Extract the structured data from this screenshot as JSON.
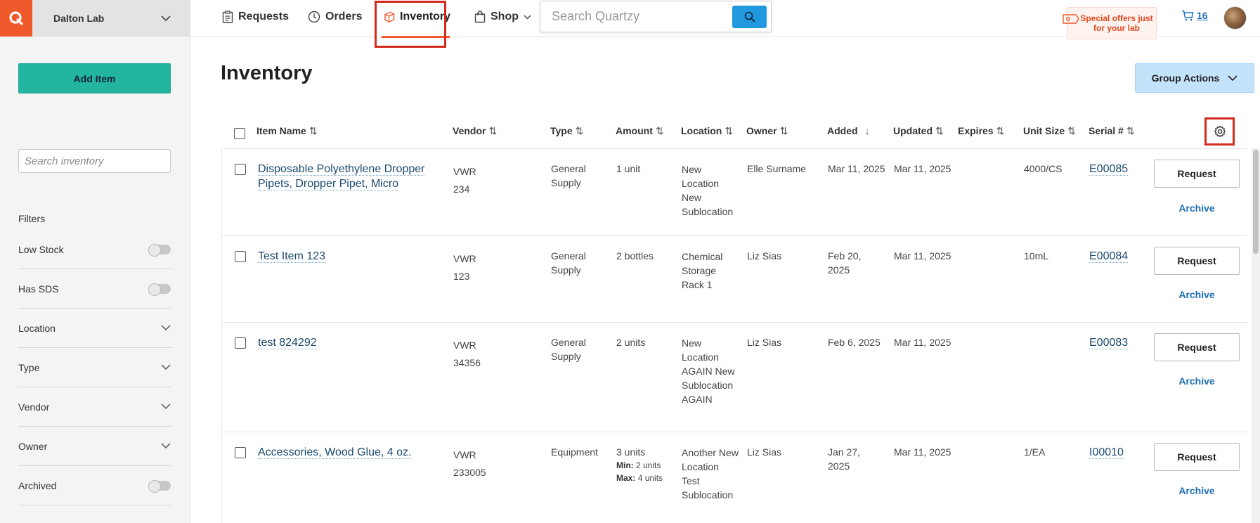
{
  "lab": {
    "name": "Dalton Lab"
  },
  "sidebar": {
    "add_item_label": "Add Item",
    "search_placeholder": "Search inventory",
    "filters_title": "Filters",
    "filters": [
      {
        "label": "Low Stock",
        "kind": "toggle"
      },
      {
        "label": "Has SDS",
        "kind": "toggle"
      },
      {
        "label": "Location",
        "kind": "dropdown"
      },
      {
        "label": "Type",
        "kind": "dropdown"
      },
      {
        "label": "Vendor",
        "kind": "dropdown"
      },
      {
        "label": "Owner",
        "kind": "dropdown"
      },
      {
        "label": "Archived",
        "kind": "toggle"
      }
    ]
  },
  "nav": {
    "items": [
      {
        "label": "Requests",
        "icon": "clipboard-icon"
      },
      {
        "label": "Orders",
        "icon": "clock-icon"
      },
      {
        "label": "Inventory",
        "icon": "box-icon",
        "active": true
      },
      {
        "label": "Shop",
        "icon": "bag-icon"
      }
    ],
    "search_placeholder": "Search Quartzy",
    "offer_text": "Special offers just for your lab",
    "cart_count": "16"
  },
  "page": {
    "title": "Inventory",
    "group_actions_label": "Group Actions"
  },
  "table": {
    "columns": {
      "item_name": "Item Name",
      "vendor": "Vendor",
      "type": "Type",
      "amount": "Amount",
      "location": "Location",
      "owner": "Owner",
      "added": "Added",
      "updated": "Updated",
      "expires": "Expires",
      "unit_size": "Unit Size",
      "serial": "Serial #"
    },
    "request_label": "Request",
    "archive_label": "Archive",
    "min_label": "Min:",
    "max_label": "Max:",
    "rows": [
      {
        "name": "Disposable Polyethylene Dropper Pipets, Dropper Pipet, Micro",
        "vendor": "VWR",
        "vendor_num": "234",
        "type": "General Supply",
        "amount": "1 unit",
        "location": "New Location New Sublocation",
        "owner": "Elle Surname",
        "added": "Mar 11, 2025",
        "updated": "Mar 11, 2025",
        "expires": "",
        "unit_size": "4000/CS",
        "serial": "E00085"
      },
      {
        "name": "Test Item 123",
        "vendor": "VWR",
        "vendor_num": "123",
        "type": "General Supply",
        "amount": "2 bottles",
        "location": "Chemical Storage Rack 1",
        "owner": "Liz Sias",
        "added": "Feb 20, 2025",
        "updated": "Mar 11, 2025",
        "expires": "",
        "unit_size": "10mL",
        "serial": "E00084"
      },
      {
        "name": "test 824292",
        "vendor": "VWR",
        "vendor_num": "34356",
        "type": "General Supply",
        "amount": "2 units",
        "location": "New Location AGAIN New Sublocation AGAIN",
        "owner": "Liz Sias",
        "added": "Feb 6, 2025",
        "updated": "Mar 11, 2025",
        "expires": "",
        "unit_size": "",
        "serial": "E00083"
      },
      {
        "name": "Accessories, Wood Glue, 4 oz.",
        "vendor": "VWR",
        "vendor_num": "233005",
        "type": "Equipment",
        "amount": "3 units",
        "min": "2 units",
        "max": "4 units",
        "location": "Another New Location Test Sublocation",
        "owner": "Liz Sias",
        "added": "Jan 27, 2025",
        "updated": "Mar 11, 2025",
        "expires": "",
        "unit_size": "1/EA",
        "serial": "I00010"
      }
    ]
  },
  "colors": {
    "brand_orange": "#f0592b",
    "add_button": "#23b5a0",
    "search_button": "#2299de",
    "highlight_red": "#d52b1e",
    "link_blue": "#1f6fb4"
  }
}
